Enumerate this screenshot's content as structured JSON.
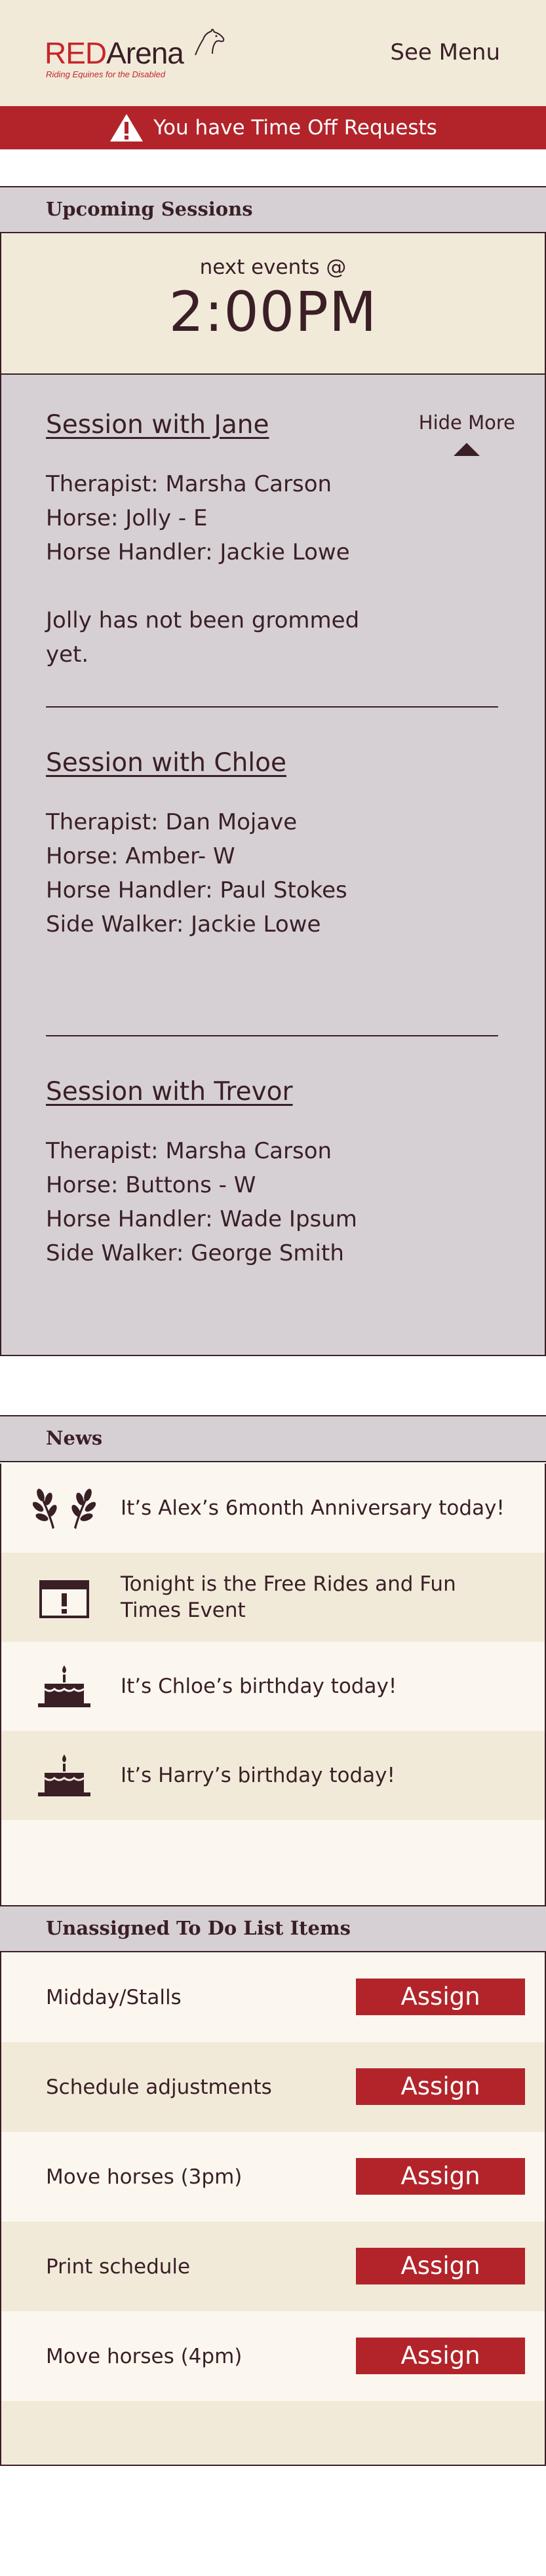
{
  "header": {
    "logo_red": "RED",
    "logo_arena": "Arena",
    "logo_tagline": "Riding Equines for the Disabled",
    "menu_label": "See Menu"
  },
  "alert": {
    "icon": "warning-triangle-icon",
    "text": "You have Time Off Requests"
  },
  "upcoming": {
    "title": "Upcoming Sessions",
    "next_label": "next events @",
    "next_time": "2:00PM",
    "toggle_label": "Hide More",
    "sessions": [
      {
        "title": "Session with Jane",
        "lines": [
          "Therapist: Marsha Carson",
          "Horse: Jolly - E",
          "Horse Handler: Jackie Lowe"
        ],
        "note": "Jolly has not been grommed yet."
      },
      {
        "title": "Session with Chloe",
        "lines": [
          "Therapist: Dan Mojave",
          "Horse: Amber- W",
          "Horse Handler: Paul Stokes",
          "Side Walker: Jackie Lowe"
        ]
      },
      {
        "title": "Session with Trevor",
        "lines": [
          "Therapist: Marsha Carson",
          "Horse: Buttons - W",
          "Horse Handler: Wade Ipsum",
          "Side Walker: George Smith"
        ]
      }
    ]
  },
  "news": {
    "title": "News",
    "items": [
      {
        "icon": "laurel-wreath-icon",
        "text": "It’s Alex’s 6month Anniversary today!"
      },
      {
        "icon": "event-calendar-icon",
        "text": "Tonight is the Free Rides and Fun Times Event"
      },
      {
        "icon": "birthday-cake-icon",
        "text": "It’s Chloe’s birthday today!"
      },
      {
        "icon": "birthday-cake-icon",
        "text": "It’s Harry’s birthday today!"
      }
    ]
  },
  "todo": {
    "title": "Unassigned To Do List Items",
    "button_label": "Assign",
    "items": [
      {
        "label": "Midday/Stalls"
      },
      {
        "label": "Schedule adjustments"
      },
      {
        "label": "Move horses (3pm)"
      },
      {
        "label": "Print schedule"
      },
      {
        "label": "Move horses (4pm)"
      }
    ]
  },
  "colors": {
    "brand_red": "#b2242a",
    "dark": "#3a1f26",
    "cream": "#f1ead9",
    "panel_gray": "#d6d0d4"
  }
}
